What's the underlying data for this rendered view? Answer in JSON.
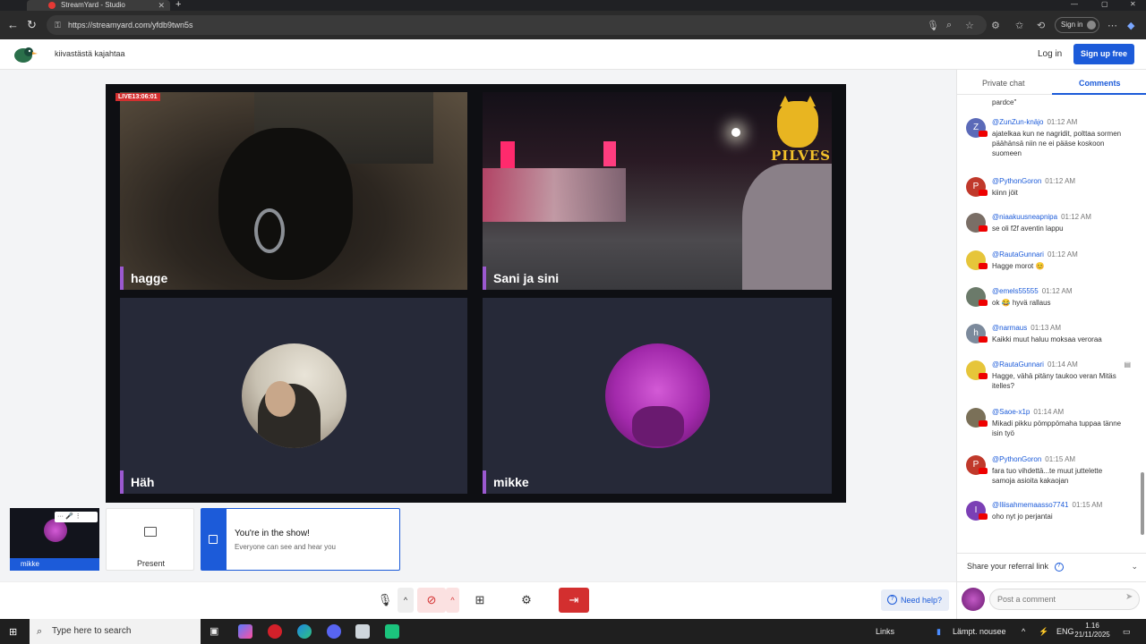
{
  "browser": {
    "tab_title": "StreamYard - Studio",
    "url": "https://streamyard.com/yfdb9twn5s",
    "signin_label": "Sign in"
  },
  "header": {
    "broadcast_title": "kiivastästä kajahtaa",
    "login_label": "Log in",
    "signup_label": "Sign up free"
  },
  "stage": {
    "live_badge": "LIVE13:06:01",
    "tiles": [
      {
        "name": "hagge"
      },
      {
        "name": "Sani ja sini",
        "logo_text": "PILVES"
      },
      {
        "name": "Häh"
      },
      {
        "name": "mikke"
      }
    ]
  },
  "self_cam": {
    "label": "mikke",
    "controls": "··· 🎤 ⋮"
  },
  "present": {
    "label": "Present"
  },
  "toast": {
    "title": "You're in the show!",
    "subtitle": "Everyone can see and hear you"
  },
  "controls": {
    "help_label": "Need help?"
  },
  "sidebar": {
    "tab_private": "Private chat",
    "tab_comments": "Comments",
    "partial_top": "pardce\"",
    "comments": [
      {
        "author": "@ZunZun-knäjo",
        "time": "01:12 AM",
        "text": "ajatelkaa kun ne nagridit, polttaa sormen päähänsä niin ne ei pääse koskoon suomeen",
        "initial": "Z",
        "color": "#5b6ab8"
      },
      {
        "author": "@PythonGoron",
        "time": "01:12 AM",
        "text": "kiinn jöit",
        "initial": "P",
        "color": "#c0392b"
      },
      {
        "author": "@niaakuusneapnipa",
        "time": "01:12 AM",
        "text": "se oli f2f aventin lappu",
        "initial": "",
        "color": "#7a6e66"
      },
      {
        "author": "@RautaGunnari",
        "time": "01:12 AM",
        "text": "Hagge morot 😊",
        "initial": "",
        "color": "#e6c53a"
      },
      {
        "author": "@emels55555",
        "time": "01:12 AM",
        "text": "ok 😂 hyvä rallaus",
        "initial": "",
        "color": "#6b7a6a"
      },
      {
        "author": "@narmaus",
        "time": "01:13 AM",
        "text": "Kaikki muut haluu moksaa veroraa",
        "initial": "h",
        "color": "#7c8a9c"
      },
      {
        "author": "@RautaGunnari",
        "time": "01:14 AM",
        "text": "Hagge, vähä pitäny taukoo veran Mitäs itelles?",
        "initial": "",
        "color": "#e6c53a"
      },
      {
        "author": "@Saoe-x1p",
        "time": "01:14 AM",
        "text": "Mikadi pikku pömppömaha tuppaa tänne isin työ",
        "initial": "",
        "color": "#7a7058"
      },
      {
        "author": "@PythonGoron",
        "time": "01:15 AM",
        "text": "fara tuo vihdettä...te muut juttelette samoja asioita kakaojan",
        "initial": "P",
        "color": "#c0392b"
      },
      {
        "author": "@Iliisahmemaasso7741",
        "time": "01:15 AM",
        "text": "oho nyt jo perjantai",
        "initial": "I",
        "color": "#7b3fb5"
      }
    ],
    "referral_label": "Share your referral link",
    "post_placeholder": "Post a comment"
  },
  "taskbar": {
    "search_placeholder": "Type here to search",
    "links_label": "Links",
    "weather": "Lämpt. nousee",
    "lang": "ENG",
    "time": "1.16",
    "date": "21/11/2025"
  }
}
